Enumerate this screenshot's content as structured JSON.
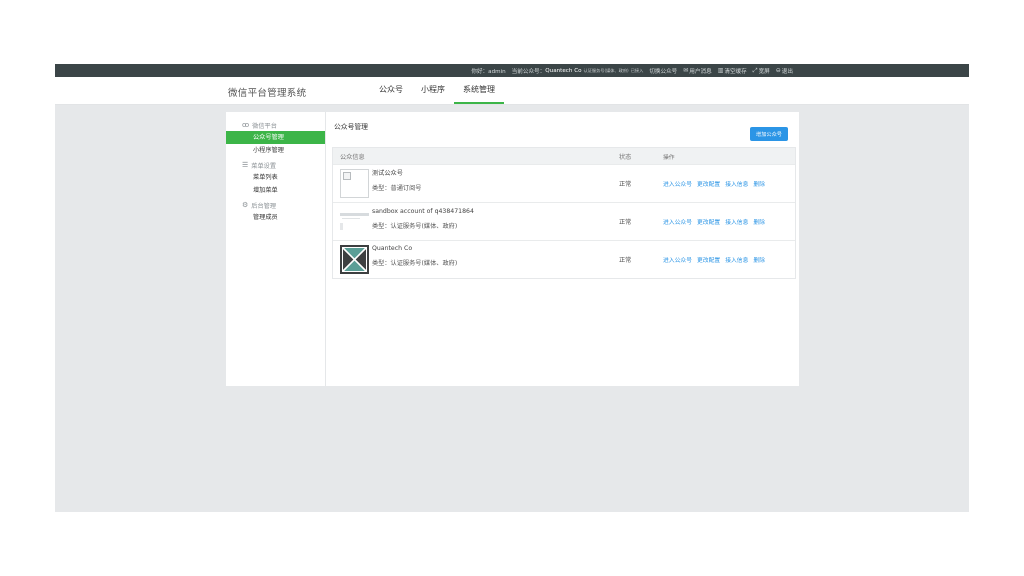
{
  "topbar": {
    "greeting": "你好：admin",
    "current_label": "当前公众号：",
    "current_account": "Quantech Co",
    "current_account_type": "认证服务号(媒体、政府)",
    "access_status": "已接入",
    "switch_account": "切换公众号",
    "user_messages": "用户消息",
    "clear_cache": "清空缓存",
    "fullscreen": "宽屏",
    "logout": "退出"
  },
  "header": {
    "brand": "微信平台管理系统",
    "nav": [
      {
        "label": "公众号"
      },
      {
        "label": "小程序"
      },
      {
        "label": "系统管理"
      }
    ]
  },
  "sidebar": {
    "sections": [
      {
        "label": "微信平台",
        "icon": "wechat-icon"
      },
      {
        "label": "菜单设置",
        "icon": "list-icon"
      },
      {
        "label": "后台管理",
        "icon": "gear-icon"
      }
    ],
    "items": [
      {
        "label": "公众号管理"
      },
      {
        "label": "小程序管理"
      },
      {
        "label": "菜单列表"
      },
      {
        "label": "增加菜单"
      },
      {
        "label": "管理成员"
      }
    ]
  },
  "content": {
    "title": "公众号管理",
    "add_button": "增加公众号",
    "columns": {
      "info": "公众信息",
      "status": "状态",
      "ops": "操作"
    },
    "rows": [
      {
        "name": "测试公众号",
        "type": "类型：普通订阅号",
        "status": "正常",
        "ops": [
          "进入公众号",
          "更改配置",
          "接入信息",
          "删除"
        ]
      },
      {
        "name": "sandbox account of q438471864",
        "type": "类型：认证服务号(媒体、政府)",
        "status": "正常",
        "ops": [
          "进入公众号",
          "更改配置",
          "接入信息",
          "删除"
        ]
      },
      {
        "name": "Quantech Co",
        "type": "类型：认证服务号(媒体、政府)",
        "status": "正常",
        "ops": [
          "进入公众号",
          "更改配置",
          "接入信息",
          "删除"
        ]
      }
    ]
  },
  "colors": {
    "topbar_bg": "#3b4547",
    "accent_green": "#3cb548",
    "link_blue": "#2b95e6",
    "canvas_bg": "#e6e8ea"
  }
}
